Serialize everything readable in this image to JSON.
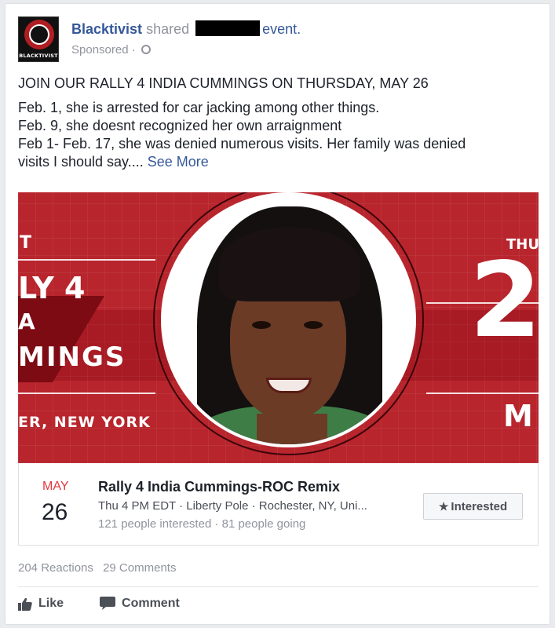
{
  "post": {
    "author": "Blacktivist",
    "action_verb": "shared",
    "action_object": "event.",
    "sponsored_label": "Sponsored ·",
    "avatar_brand": "BLACKTIVIST",
    "headline": "JOIN OUR RALLY 4 INDIA CUMMINGS ON THURSDAY, MAY 26",
    "body_lines": [
      "Feb. 1, she is arrested for car jacking among other things.",
      "Feb. 9, she doesnt recognized her own arraignment",
      "Feb 1- Feb. 17, she was denied numerous visits. Her family was denied",
      "visits I should say...."
    ],
    "see_more": "See More"
  },
  "banner": {
    "left_texts": [
      "T",
      "LY 4",
      "A",
      "MINGS",
      "ER, NEW YORK"
    ],
    "right_texts": [
      "THU",
      "2",
      "M"
    ]
  },
  "event": {
    "month": "MAY",
    "day": "26",
    "title": "Rally 4 India Cummings-ROC Remix",
    "details": "Thu 4 PM EDT · Liberty Pole · Rochester, NY, Uni...",
    "stats": "121 people interested · 81 people going",
    "interested_label": "Interested"
  },
  "footer": {
    "reactions": "204 Reactions",
    "comments": "29 Comments",
    "like_label": "Like",
    "comment_label": "Comment"
  },
  "icons": {
    "globe": "globe-icon",
    "star": "star-icon",
    "like": "thumbs-up-icon",
    "comment": "speech-bubble-icon"
  },
  "colors": {
    "link_blue": "#365899",
    "banner_red": "#b8252d",
    "month_red": "#e0393e"
  }
}
